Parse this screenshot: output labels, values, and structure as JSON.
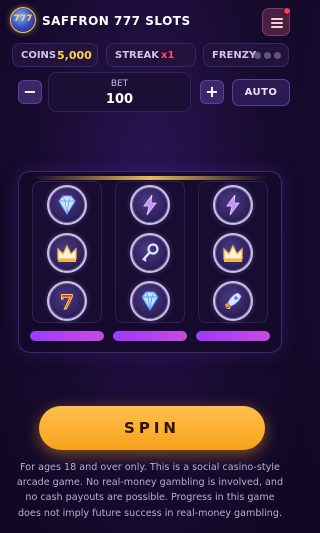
{
  "header": {
    "logo_text": "777",
    "title": "SAFFRON 777 SLOTS",
    "menu_icon": "hamburger-icon",
    "notification_color": "#ff3b54"
  },
  "stats": {
    "coins_label": "COINS",
    "coins_value": "5,000",
    "streak_label": "STREAK",
    "streak_value": "x1",
    "frenzy_label": "FRENZY",
    "frenzy_dots": 3
  },
  "bet": {
    "minus_label": "−",
    "label": "BET",
    "value": "100",
    "plus_label": "+",
    "auto_label": "AUTO"
  },
  "reels": [
    {
      "symbols": [
        "diamond-icon",
        "crown-icon",
        "seven-icon"
      ]
    },
    {
      "symbols": [
        "lightning-icon",
        "key-icon",
        "diamond-icon"
      ]
    },
    {
      "symbols": [
        "lightning-icon",
        "crown-icon",
        "rocket-icon"
      ]
    }
  ],
  "spin": {
    "label": "SPIN"
  },
  "disclaimer": "For ages 18 and over only. This is a social casino-style arcade game. No real-money gambling is involved, and no cash payouts are possible. Progress in this game does not imply future success in real-money gambling.",
  "colors": {
    "accent_gold": "#f7a21a",
    "streak_red": "#ff4b6e",
    "reel_bar": "#b445f0"
  }
}
